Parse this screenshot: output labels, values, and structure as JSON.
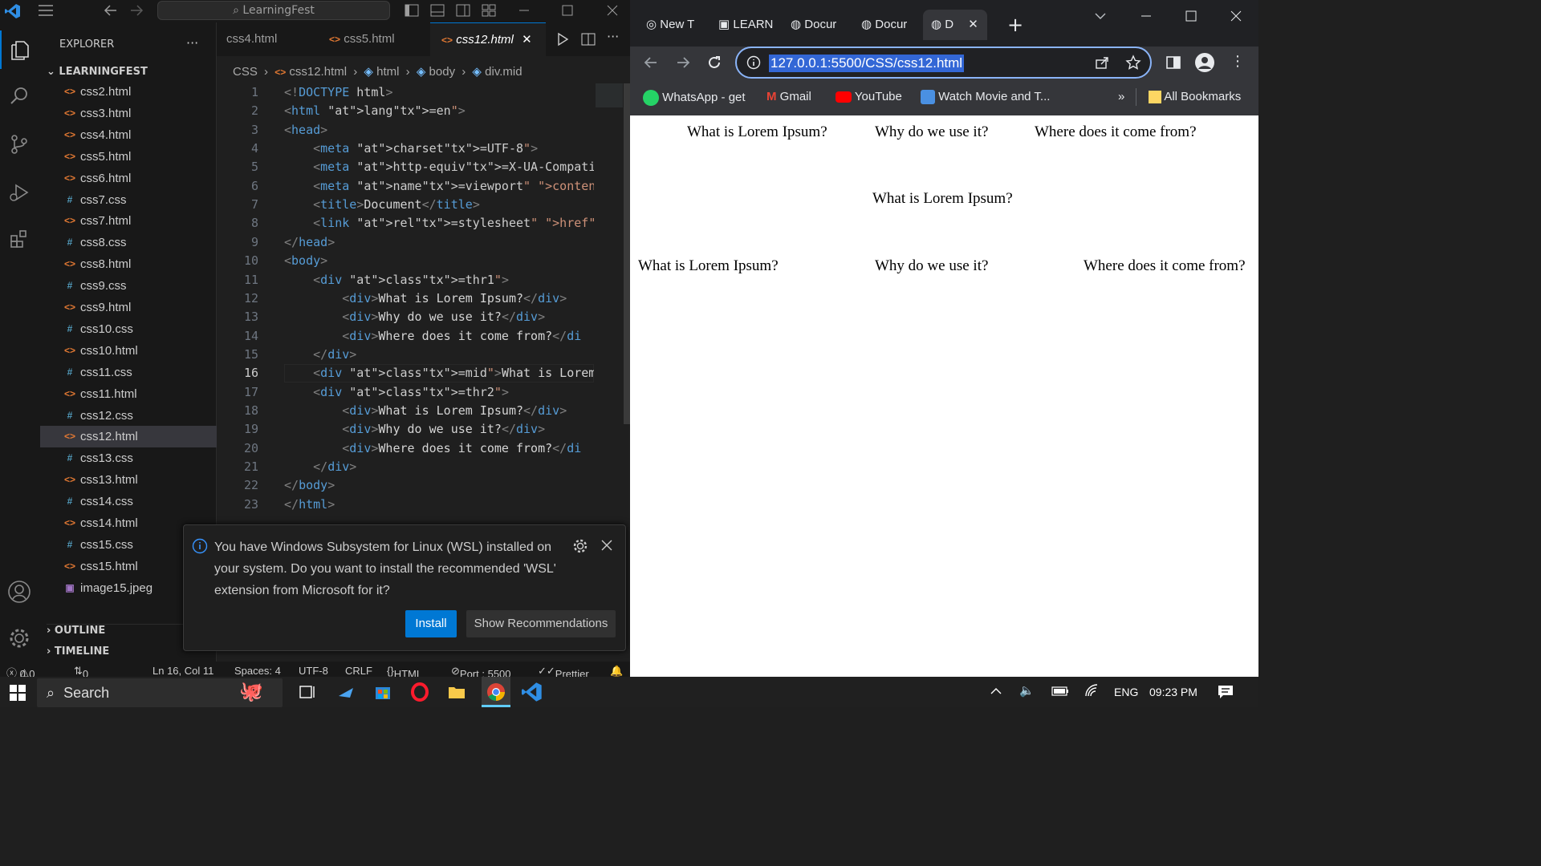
{
  "vscode": {
    "command_center": "LearningFest",
    "explorer_title": "EXPLORER",
    "root_folder": "LEARNINGFEST",
    "files": [
      {
        "name": "css2.html",
        "type": "html"
      },
      {
        "name": "css3.html",
        "type": "html"
      },
      {
        "name": "css4.html",
        "type": "html"
      },
      {
        "name": "css5.html",
        "type": "html"
      },
      {
        "name": "css6.html",
        "type": "html"
      },
      {
        "name": "css7.css",
        "type": "css"
      },
      {
        "name": "css7.html",
        "type": "html"
      },
      {
        "name": "css8.css",
        "type": "css"
      },
      {
        "name": "css8.html",
        "type": "html"
      },
      {
        "name": "css9.css",
        "type": "css"
      },
      {
        "name": "css9.html",
        "type": "html"
      },
      {
        "name": "css10.css",
        "type": "css"
      },
      {
        "name": "css10.html",
        "type": "html"
      },
      {
        "name": "css11.css",
        "type": "css"
      },
      {
        "name": "css11.html",
        "type": "html"
      },
      {
        "name": "css12.css",
        "type": "css"
      },
      {
        "name": "css12.html",
        "type": "html",
        "active": true
      },
      {
        "name": "css13.css",
        "type": "css"
      },
      {
        "name": "css13.html",
        "type": "html"
      },
      {
        "name": "css14.css",
        "type": "css"
      },
      {
        "name": "css14.html",
        "type": "html"
      },
      {
        "name": "css15.css",
        "type": "css"
      },
      {
        "name": "css15.html",
        "type": "html"
      },
      {
        "name": "image15.jpeg",
        "type": "img"
      }
    ],
    "outline": "OUTLINE",
    "timeline": "TIMELINE",
    "tabs": [
      "css4.html",
      "css5.html",
      "css12.html"
    ],
    "breadcrumb": [
      "CSS",
      "css12.html",
      "html",
      "body",
      "div.mid"
    ],
    "current_line": 16,
    "code_lines": [
      "<!DOCTYPE html>",
      "<html lang=\"en\">",
      "<head>",
      "    <meta charset=\"UTF-8\">",
      "    <meta http-equiv=\"X-UA-Compatible\" co",
      "    <meta name=\"viewport\" content=\"width=",
      "    <title>Document</title>",
      "    <link rel=\"stylesheet\" href=\"css12.c",
      "</head>",
      "<body>",
      "    <div class=\"thr1\">",
      "        <div>What is Lorem Ipsum?</div>",
      "        <div>Why do we use it?</div>",
      "        <div>Where does it come from?</di",
      "    </div>",
      "    <div class=\"mid\">What is Lorem Ipsum",
      "    <div class=\"thr2\">",
      "        <div>What is Lorem Ipsum?</div>",
      "        <div>Why do we use it?</div>",
      "        <div>Where does it come from?</di",
      "    </div>",
      "</body>",
      "</html>"
    ],
    "notification": {
      "message": "You have Windows Subsystem for Linux (WSL) installed on your system. Do you want to install the recommended 'WSL' extension from Microsoft for it?",
      "install": "Install",
      "recommendations": "Show Recommendations"
    },
    "status": {
      "errors": "0",
      "warnings": "0",
      "ports": "0",
      "position": "Ln 16, Col 11",
      "spaces": "Spaces: 4",
      "encoding": "UTF-8",
      "eol": "CRLF",
      "language": "HTML",
      "port": "Port : 5500",
      "prettier": "Prettier"
    }
  },
  "chrome": {
    "tabs": [
      "New T",
      "LEARN",
      "Docur",
      "Docur",
      "D"
    ],
    "url": "127.0.0.1:5500/CSS/css12.html",
    "bookmarks": [
      "WhatsApp - get",
      "Gmail",
      "YouTube",
      "Watch Movie and T...",
      "All Bookmarks"
    ],
    "page": {
      "row1": [
        "What is Lorem Ipsum?",
        "Why do we use it?",
        "Where does it come from?"
      ],
      "mid": "What is Lorem Ipsum?",
      "row2": [
        "What is Lorem Ipsum?",
        "Why do we use it?",
        "Where does it come from?"
      ]
    }
  },
  "taskbar": {
    "search": "Search",
    "lang": "ENG",
    "time": "09:23 PM"
  }
}
